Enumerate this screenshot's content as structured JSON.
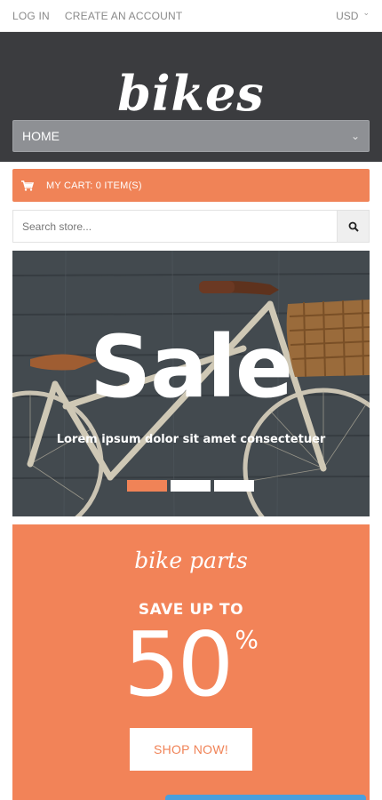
{
  "topbar": {
    "login": "LOG IN",
    "create_account": "CREATE AN ACCOUNT",
    "currency": "USD"
  },
  "header": {
    "logo": "bikes"
  },
  "nav": {
    "selected": "HOME"
  },
  "cart": {
    "label": "MY CART: 0 ITEM(S)"
  },
  "search": {
    "placeholder": "Search store..."
  },
  "banner": {
    "title": "Sale",
    "subtitle": "Lorem ipsum dolor sit amet consectetuer",
    "slides": 3,
    "active_slide": 1
  },
  "promo": {
    "script_title": "bike parts",
    "save_text": "SAVE UP TO",
    "percent": "50",
    "percent_sign": "%",
    "button": "SHOP NOW!"
  },
  "colors": {
    "accent": "#f08357",
    "header_bg": "#3b3c3f",
    "nav_bg": "#8e9094"
  },
  "icons": {
    "cart": "shopping-cart-icon",
    "search": "search-icon",
    "chevron": "chevron-down-icon"
  }
}
